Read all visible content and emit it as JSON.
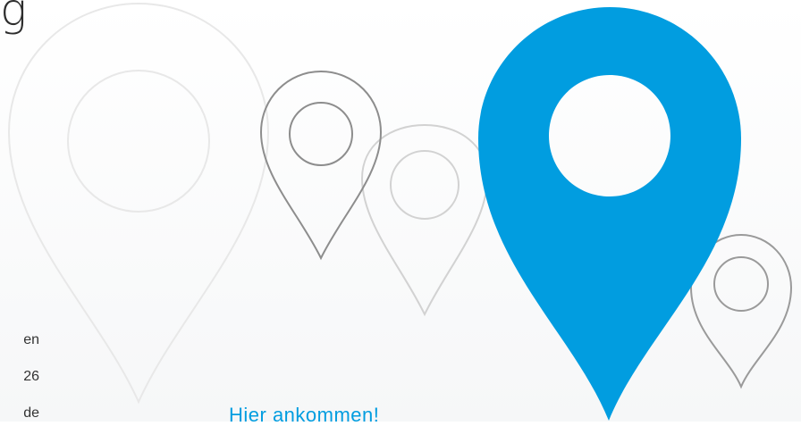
{
  "header": {
    "title_fragment": "g"
  },
  "address": {
    "line1_fragment": "en",
    "line2_fragment": "26",
    "line3_fragment": "de"
  },
  "cta": {
    "label": "Hier ankommen!"
  },
  "icons": [
    "map-pin-icon"
  ],
  "colors": {
    "accent": "#019de0",
    "pin_light": "#e6e6e6",
    "pin_dark": "#8a8a8a",
    "pin_mid": "#c8c8c8",
    "text": "#2d2d2d"
  }
}
